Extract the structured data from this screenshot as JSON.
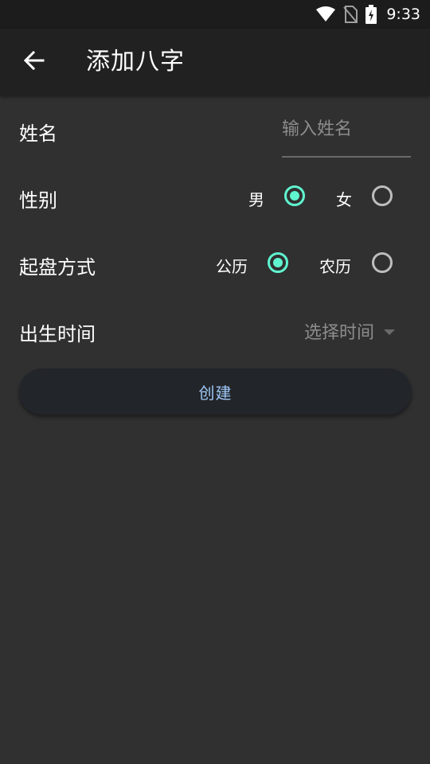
{
  "status_bar": {
    "time": "9:33",
    "icons": [
      "wifi-icon",
      "no-sim-icon",
      "battery-charging-icon"
    ]
  },
  "app_bar": {
    "back_icon": "arrow-left-icon",
    "title": "添加八字"
  },
  "form": {
    "name": {
      "label": "姓名",
      "placeholder": "输入姓名",
      "value": ""
    },
    "gender": {
      "label": "性别",
      "options": [
        {
          "label": "男",
          "selected": true
        },
        {
          "label": "女",
          "selected": false
        }
      ]
    },
    "calendar": {
      "label": "起盘方式",
      "options": [
        {
          "label": "公历",
          "selected": true
        },
        {
          "label": "农历",
          "selected": false
        }
      ]
    },
    "birth_time": {
      "label": "出生时间",
      "value": "选择时间"
    },
    "submit_label": "创建"
  },
  "colors": {
    "background": "#303030",
    "app_bar": "#212121",
    "accent_radio": "#5ff5d0",
    "button_text": "#9ec7f5"
  }
}
